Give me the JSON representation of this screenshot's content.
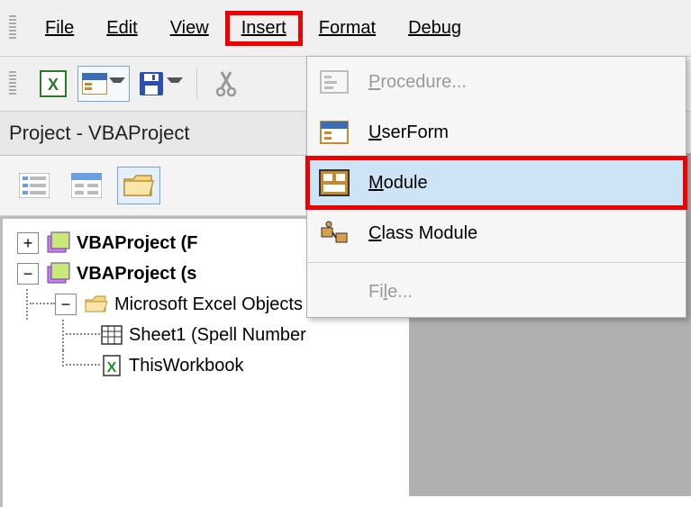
{
  "menubar": {
    "items": [
      "File",
      "Edit",
      "View",
      "Insert",
      "Format",
      "Debug"
    ],
    "highlighted": 3
  },
  "panel": {
    "title": "Project - VBAProject"
  },
  "tree": {
    "proj1": "VBAProject (F",
    "proj2": "VBAProject (s",
    "folder": "Microsoft Excel Objects",
    "sheet": "Sheet1 (Spell Number",
    "wb": "ThisWorkbook"
  },
  "dropdown": {
    "items": [
      {
        "label": "Procedure...",
        "u": "P",
        "icon": "procedure",
        "disabled": true
      },
      {
        "label": "UserForm",
        "u": "U",
        "icon": "userform"
      },
      {
        "label": "Module",
        "u": "M",
        "icon": "module",
        "highlight": true,
        "ring": true
      },
      {
        "label": "Class Module",
        "u": "C",
        "icon": "class"
      },
      {
        "label": "File...",
        "u": "l",
        "icon": "",
        "disabled": true,
        "sepBefore": true
      }
    ]
  }
}
